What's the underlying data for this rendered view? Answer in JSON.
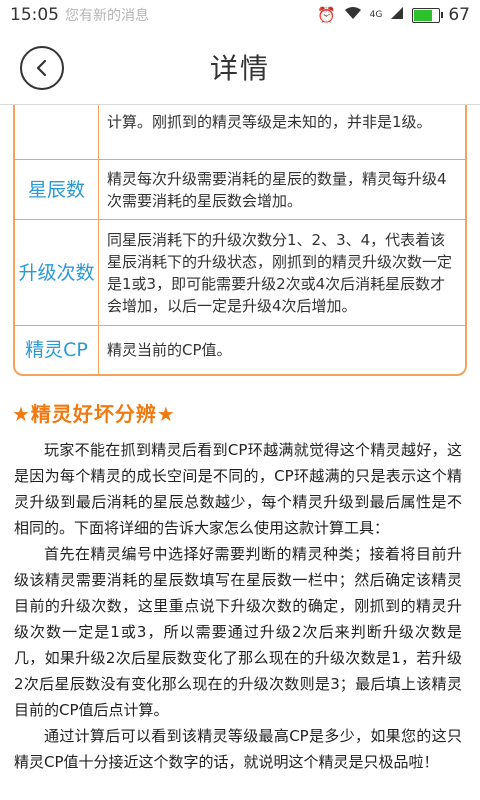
{
  "status_bar": {
    "time": "15:05",
    "notification_text": "您有新的消息",
    "network": "4G",
    "battery": "67"
  },
  "header": {
    "title": "详情"
  },
  "table": {
    "partial_row_text": "计算。刚抓到的精灵等级是未知的，并非是1级。",
    "rows": [
      {
        "label": "星辰数",
        "desc": "精灵每次升级需要消耗的星辰的数量，精灵每升级4次需要消耗的星辰数会增加。"
      },
      {
        "label": "升级次数",
        "desc": "同星辰消耗下的升级次数分1、2、3、4，代表着该星辰消耗下的升级状态，刚抓到的精灵升级次数一定是1或3，即可能需要升级2次或4次后消耗星辰数才会增加，以后一定是升级4次后增加。"
      },
      {
        "label": "精灵CP",
        "desc": "精灵当前的CP值。"
      }
    ]
  },
  "section": {
    "title": "★精灵好坏分辨★",
    "paragraphs": [
      "玩家不能在抓到精灵后看到CP环越满就觉得这个精灵越好，这是因为每个精灵的成长空间是不同的，CP环越满的只是表示这个精灵升级到最后消耗的星辰总数越少，每个精灵升级到最后属性是不相同的。下面将详细的告诉大家怎么使用这款计算工具：",
      "首先在精灵编号中选择好需要判断的精灵种类；接着将目前升级该精灵需要消耗的星辰数填写在星辰数一栏中；然后确定该精灵目前的升级次数，这里重点说下升级次数的确定，刚抓到的精灵升级次数一定是1或3，所以需要通过升级2次后来判断升级次数是几，如果升级2次后星辰数变化了那么现在的升级次数是1，若升级2次后星辰数没有变化那么现在的升级次数则是3；最后填上该精灵目前的CP值后点计算。",
      "通过计算后可以看到该精灵等级最高CP是多少，如果您的这只精灵CP值十分接近这个数字的话，就说明这个精灵是只极品啦！"
    ]
  },
  "colors": {
    "accent_orange": "#f07a12",
    "label_blue": "#2a9ad6",
    "table_border": "#f3a35a",
    "battery_green": "#2ec12e"
  },
  "icons": [
    "back-arrow-icon",
    "alarm-icon",
    "wifi-icon",
    "signal-icon",
    "battery-icon"
  ]
}
